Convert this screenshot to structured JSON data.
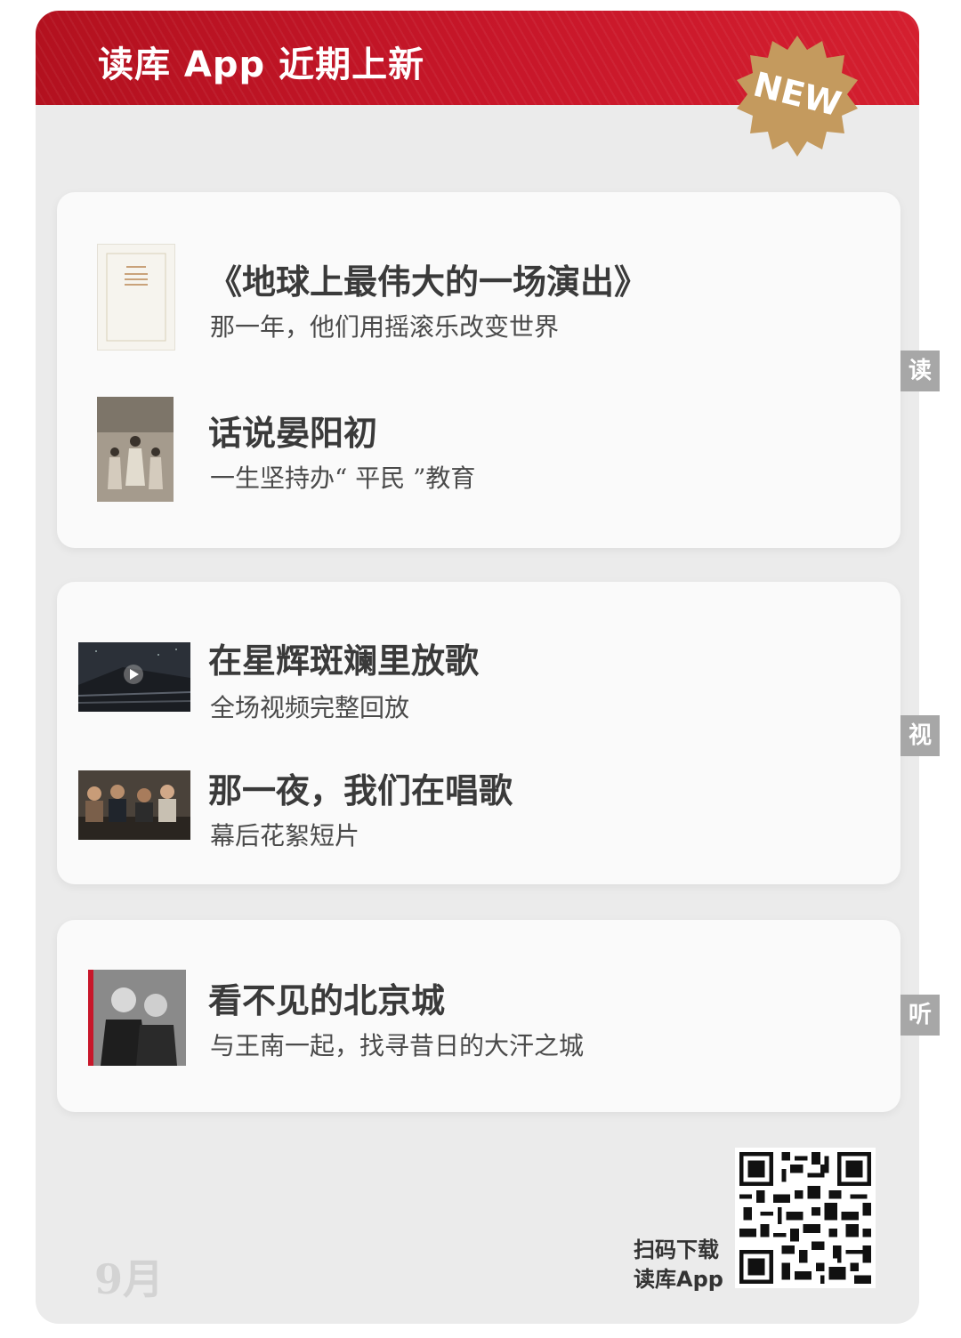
{
  "header": {
    "title": "读库 App 近期上新",
    "badge": "NEW",
    "colors": {
      "banner": "#c8172a",
      "badge": "#c49a5e"
    }
  },
  "sections": {
    "read": {
      "tab": "读",
      "items": [
        {
          "title": "《地球上最伟大的一场演出》",
          "subtitle": "那一年，他们用摇滚乐改变世界",
          "cover_text": "地球上\n最伟大的\n一场演出",
          "thumb_icon": "book-cover-white"
        },
        {
          "title": "话说晏阳初",
          "subtitle": "一生坚持办“ 平民 ”教育",
          "thumb_icon": "book-cover-illustration"
        }
      ]
    },
    "video": {
      "tab": "视",
      "items": [
        {
          "title": "在星辉斑斓里放歌",
          "subtitle": "全场视频完整回放",
          "thumb_icon": "video-thumbnail-stage"
        },
        {
          "title": "那一夜，我们在唱歌",
          "subtitle": "幕后花絮短片",
          "thumb_icon": "video-thumbnail-people"
        }
      ]
    },
    "listen": {
      "tab": "听",
      "items": [
        {
          "title": "看不见的北京城",
          "subtitle": "与王南一起，找寻昔日的大汗之城",
          "thumb_icon": "audio-cover-portrait"
        }
      ]
    }
  },
  "footer": {
    "month": "9月",
    "qr_line1": "扫码下载",
    "qr_line2": "读库App",
    "qr_icon": "qr-code"
  }
}
